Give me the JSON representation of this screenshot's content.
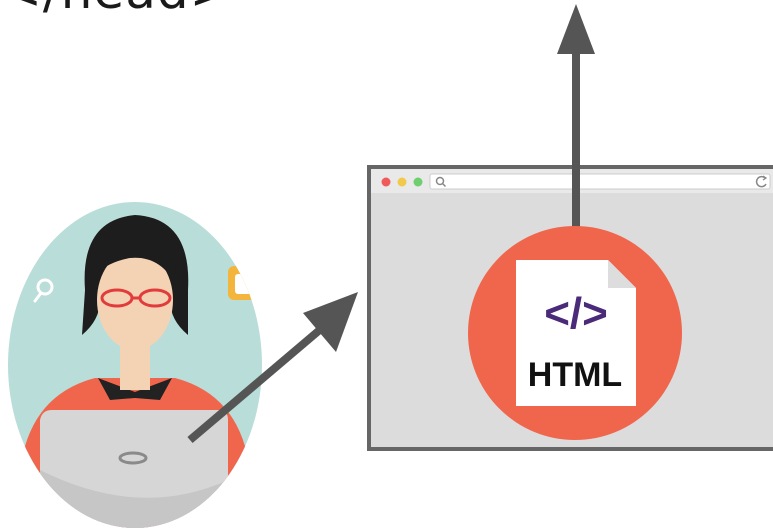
{
  "top_text": "</head>",
  "file_label": "HTML",
  "file_code_symbol": "</>",
  "colors": {
    "arrow": "#555555",
    "circle_red": "#f0664c",
    "browser_frame": "#666666",
    "browser_body": "#dcdcdc",
    "avatar_bg": "#b9ddd9",
    "shirt": "#f0664c",
    "code_purple": "#4b2a7a",
    "code_violet": "#b46ed6"
  },
  "icons": {
    "search": "search-icon",
    "refresh": "refresh-icon",
    "document": "html-file-icon"
  }
}
